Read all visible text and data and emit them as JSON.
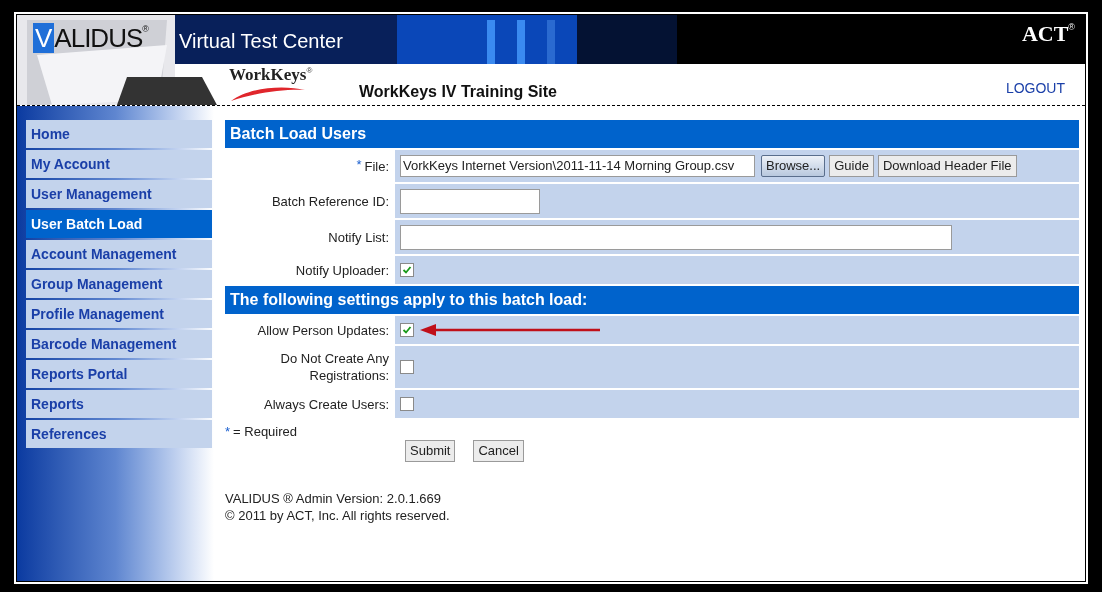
{
  "header": {
    "brand": {
      "initial": "V",
      "rest": "ALIDUS",
      "registered": "®"
    },
    "product": "Virtual Test Center",
    "company": {
      "name": "ACT",
      "registered": "®"
    },
    "program": {
      "name": "WorkKeys",
      "registered": "®"
    },
    "site_title": "WorkKeys IV Training Site",
    "logout": "LOGOUT"
  },
  "sidebar": {
    "items": [
      {
        "label": "Home",
        "selected": false
      },
      {
        "label": "My Account",
        "selected": false
      },
      {
        "label": "User Management",
        "selected": false
      },
      {
        "label": "User Batch Load",
        "selected": true
      },
      {
        "label": "Account Management",
        "selected": false
      },
      {
        "label": "Group Management",
        "selected": false
      },
      {
        "label": "Profile Management",
        "selected": false
      },
      {
        "label": "Barcode Management",
        "selected": false
      },
      {
        "label": "Reports Portal",
        "selected": false
      },
      {
        "label": "Reports",
        "selected": false
      },
      {
        "label": "References",
        "selected": false
      }
    ]
  },
  "form": {
    "title": "Batch Load Users",
    "rows": [
      {
        "kind": "file",
        "required_mark": "*",
        "label": "File:",
        "value": "VorkKeys Internet Version\\2011-11-14 Morning Group.csv",
        "buttons": [
          {
            "label": "Browse...",
            "kind": "primary"
          },
          {
            "label": "Guide",
            "kind": "plain"
          },
          {
            "label": "Download Header File",
            "kind": "plain"
          }
        ]
      },
      {
        "kind": "shortfield",
        "label": "Batch Reference ID:"
      },
      {
        "kind": "longfield",
        "label": "Notify List:"
      },
      {
        "kind": "checkbox",
        "label": "Notify Uploader:",
        "checked": true
      }
    ],
    "section": "The following settings apply to this batch load:",
    "settings": [
      {
        "kind": "checkbox",
        "label": "Allow Person Updates:",
        "checked": true,
        "annotated": true
      },
      {
        "kind": "checkbox",
        "label": "Do Not Create Any Registrations:",
        "checked": false,
        "annotated": false
      },
      {
        "kind": "checkbox",
        "label": "Always Create Users:",
        "checked": false,
        "annotated": false
      }
    ],
    "required_note": {
      "mark": "*",
      "text": "= Required"
    },
    "actions": [
      "Submit",
      "Cancel"
    ]
  },
  "footer": [
    "VALIDUS ® Admin Version: 2.0.1.669",
    "© 2011 by ACT, Inc. All rights reserved."
  ]
}
